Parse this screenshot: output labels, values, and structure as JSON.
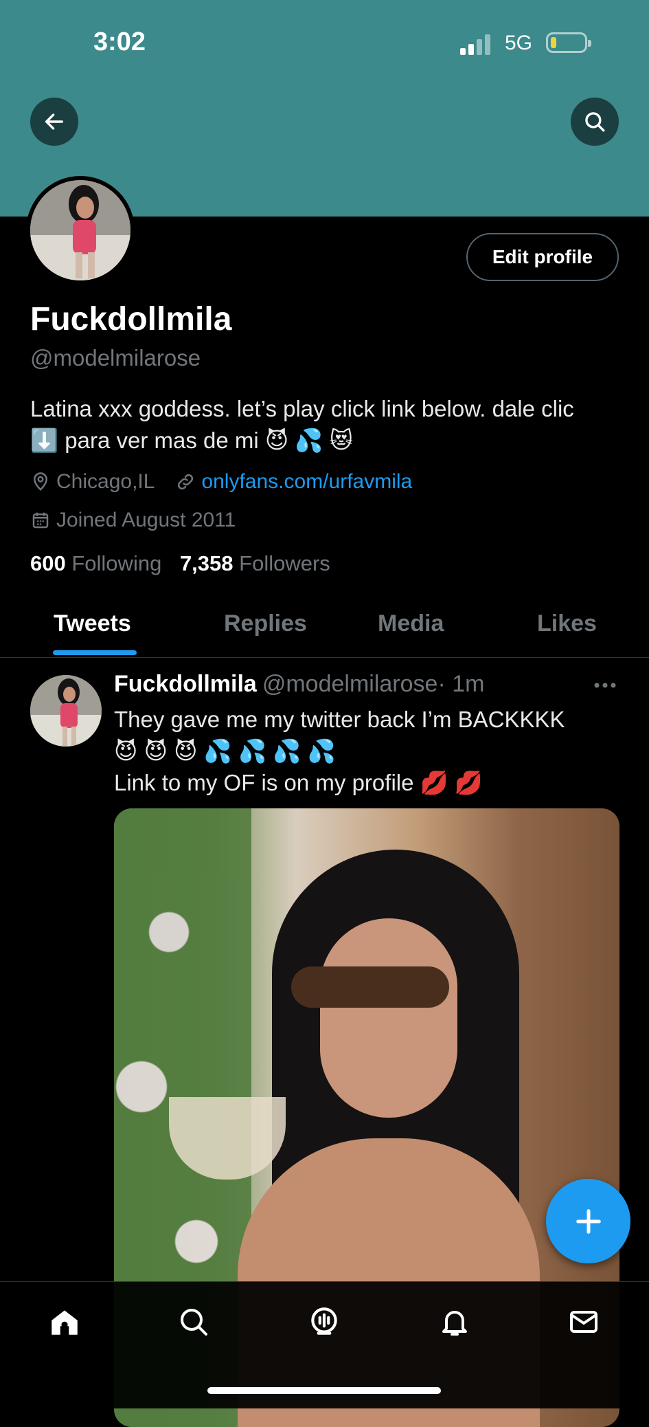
{
  "status_bar": {
    "time": "3:02",
    "network": "5G",
    "battery_level": 0.1
  },
  "profile": {
    "edit_label": "Edit profile",
    "name": "Fuckdollmila",
    "handle": "@modelmilarose",
    "bio_line1": "Latina xxx goddess. let’s play click link below. dale clic",
    "bio_line2": "⬇️ para ver mas de mi 😈 💦 😻",
    "location": "Chicago,IL",
    "website": "onlyfans.com/urfavmila",
    "joined": "Joined August 2011",
    "following_count": "600",
    "following_label": "Following",
    "followers_count": "7,358",
    "followers_label": "Followers"
  },
  "tabs": [
    {
      "label": "Tweets",
      "active": true
    },
    {
      "label": "Replies",
      "active": false
    },
    {
      "label": "Media",
      "active": false
    },
    {
      "label": "Likes",
      "active": false
    }
  ],
  "tweet": {
    "author_name": "Fuckdollmila",
    "author_handle": "@modelmilarose",
    "time": "· 1m",
    "text": "They gave me my twitter back I’m BACKKKK\n😈 😈 😈 💦 💦 💦 💦\nLink to my OF is on my profile 💋 💋"
  },
  "colors": {
    "banner": "#3c8a8b",
    "accent": "#1d9bf0",
    "background": "#000000"
  },
  "icons": {
    "back": "arrow-left-icon",
    "search": "search-icon",
    "location": "location-pin-icon",
    "link": "link-icon",
    "calendar": "calendar-icon",
    "more": "more-dots-icon",
    "compose": "plus-icon",
    "nav": [
      "home-icon",
      "search-icon",
      "spaces-icon",
      "bell-icon",
      "mail-icon"
    ]
  }
}
